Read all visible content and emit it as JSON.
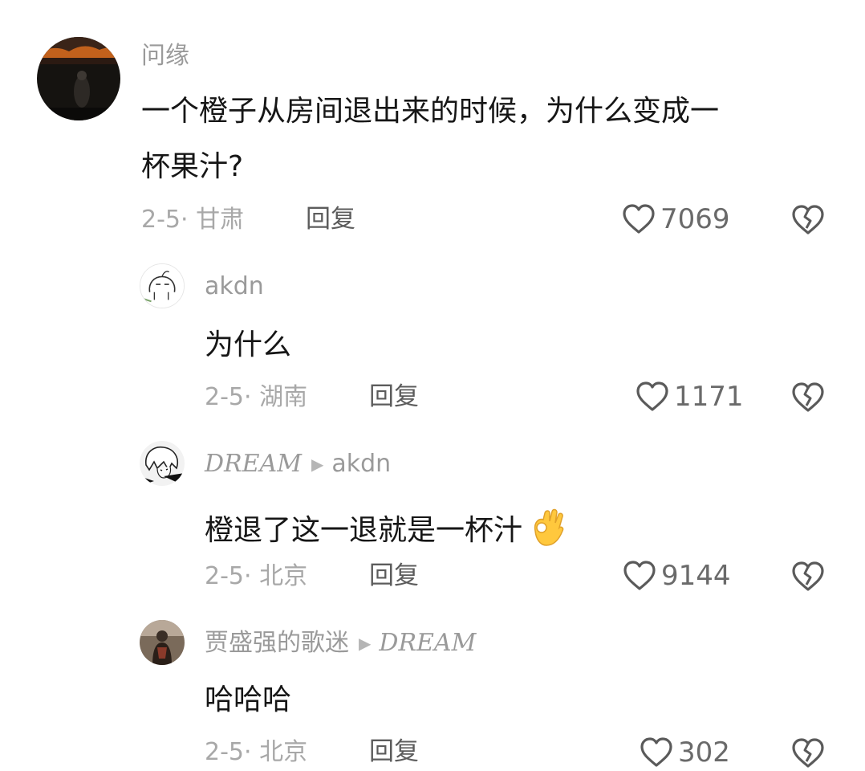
{
  "comments": [
    {
      "username": "问缘",
      "text_line1": "一个橙子从房间退出来的时候，为什么变成一",
      "text_line2": "杯果汁?",
      "date": "2-5· 甘肃",
      "reply_label": "回复",
      "likes": "7069",
      "avatar_icon": "avatar-dark-landscape-icon"
    },
    {
      "username": "akdn",
      "text": "为什么",
      "date": "2-5· 湖南",
      "reply_label": "回复",
      "likes": "1171",
      "avatar_icon": "avatar-sketch-face-icon"
    },
    {
      "username": "DREAM",
      "reply_to": "akdn",
      "text": "橙退了这一退就是一杯汁",
      "emoji": "ok-hand-emoji",
      "date": "2-5· 北京",
      "reply_label": "回复",
      "likes": "9144",
      "avatar_icon": "avatar-anime-icon"
    },
    {
      "username": "贾盛强的歌迷",
      "reply_to": "DREAM",
      "text": "哈哈哈",
      "date": "2-5· 北京",
      "reply_label": "回复",
      "likes": "302",
      "avatar_icon": "avatar-person-icon"
    }
  ],
  "colors": {
    "text": "#161616",
    "username": "#9a9a9a",
    "meta": "#a8a8a8",
    "icon": "#5a5a5a"
  }
}
